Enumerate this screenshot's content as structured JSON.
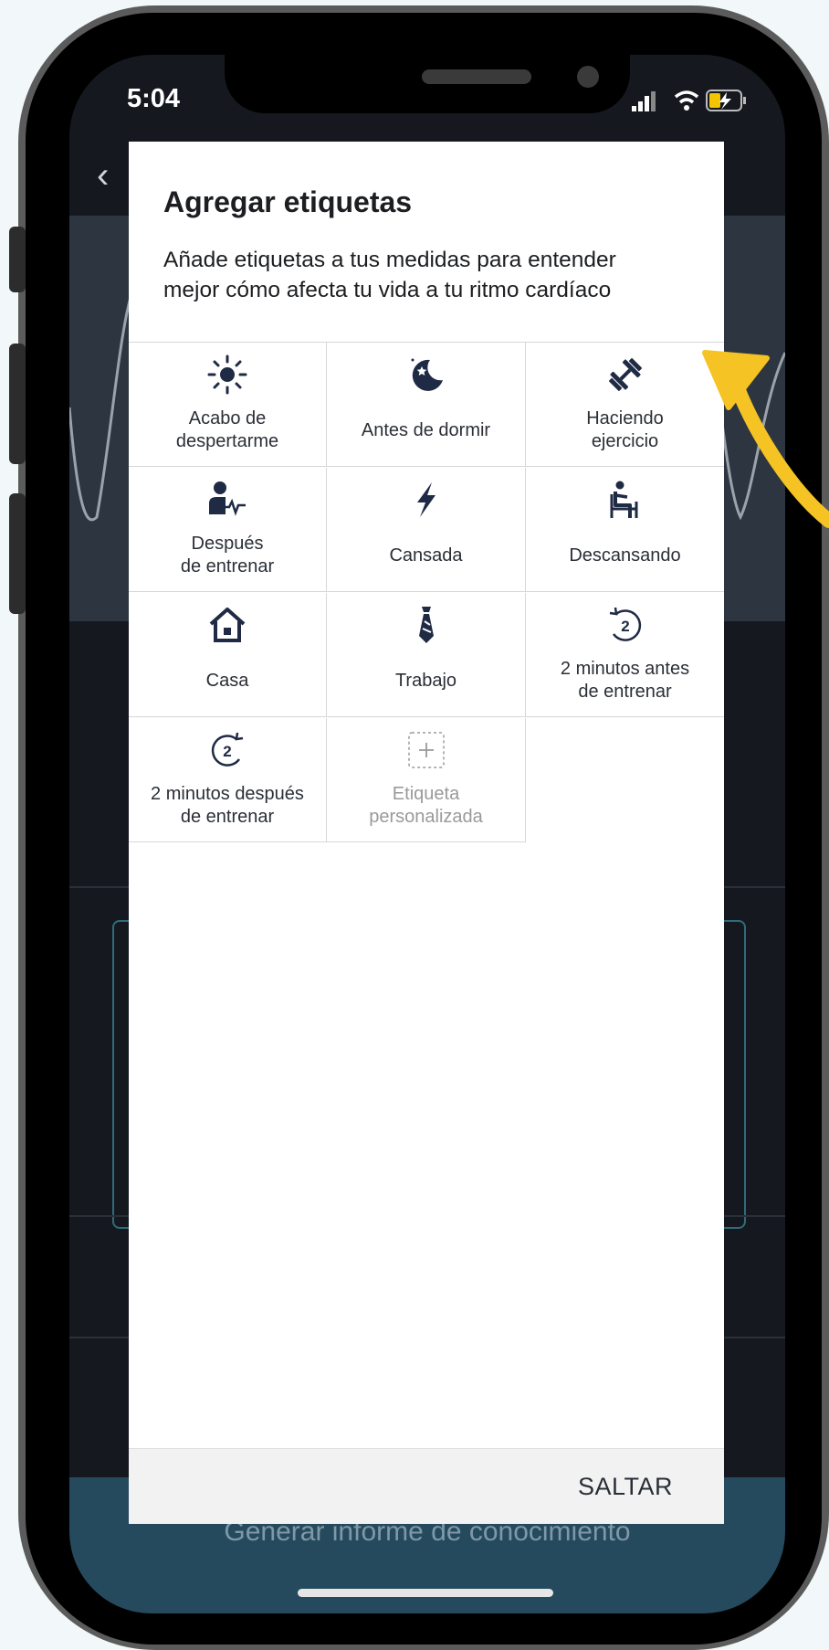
{
  "status_bar": {
    "time": "5:04"
  },
  "modal": {
    "title": "Agregar etiquetas",
    "description_line1": "Añade etiquetas a tus medidas para entender",
    "description_line2": "mejor cómo afecta tu vida a tu ritmo cardíaco",
    "tags": [
      {
        "icon": "sun-icon",
        "line1": "Acabo de",
        "line2": "despertarme"
      },
      {
        "icon": "moon-icon",
        "line1": "Antes de dormir",
        "line2": ""
      },
      {
        "icon": "dumbbell-icon",
        "line1": "Haciendo",
        "line2": "ejercicio"
      },
      {
        "icon": "person-heartbeat-icon",
        "line1": "Después",
        "line2": "de entrenar"
      },
      {
        "icon": "lightning-icon",
        "line1": "Cansada",
        "line2": ""
      },
      {
        "icon": "person-sitting-icon",
        "line1": "Descansando",
        "line2": ""
      },
      {
        "icon": "house-icon",
        "line1": "Casa",
        "line2": ""
      },
      {
        "icon": "tie-icon",
        "line1": "Trabajo",
        "line2": ""
      },
      {
        "icon": "countdown-2-icon",
        "line1": "2 minutos antes",
        "line2": "de entrenar"
      },
      {
        "icon": "countup-2-icon",
        "line1": "2 minutos después",
        "line2": "de entrenar"
      },
      {
        "icon": "plus-box-icon",
        "line1": "Etiqueta",
        "line2": "personalizada"
      }
    ],
    "skip_label": "SALTAR"
  },
  "background_app": {
    "footer_button": "Generar informe de conocimiento"
  },
  "colors": {
    "icon": "#1f2a44",
    "arrow": "#f6c325",
    "footer": "#264a5d"
  }
}
